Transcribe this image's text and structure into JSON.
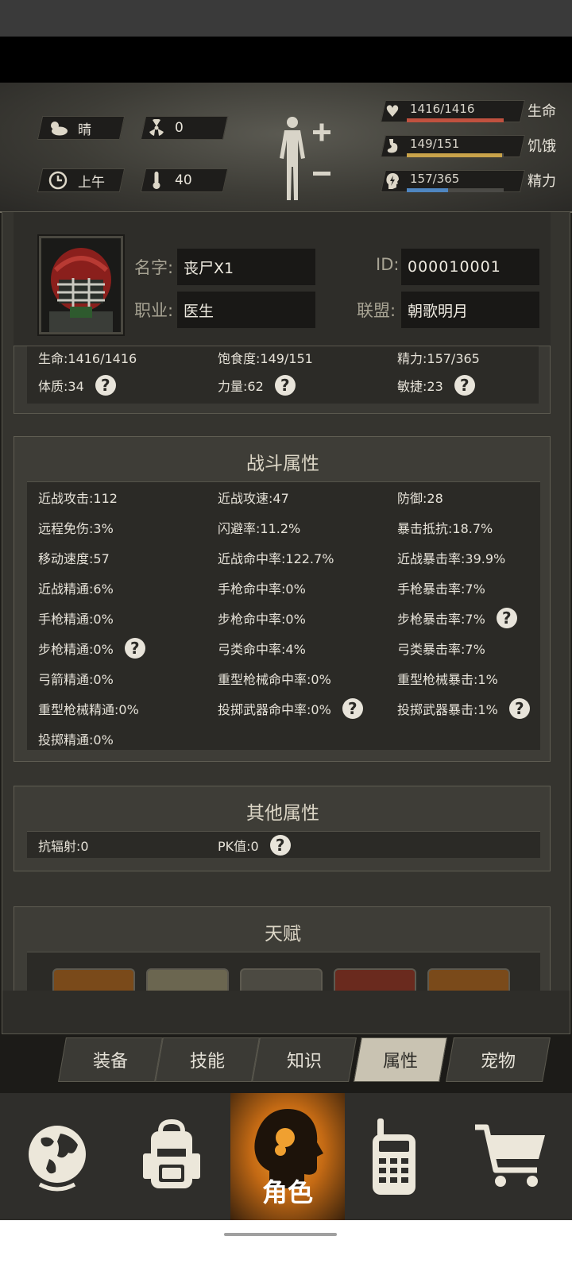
{
  "hud": {
    "weather": {
      "icon": "cloud-sun-icon",
      "value": "晴"
    },
    "radiation": {
      "icon": "radiation-icon",
      "value": "0"
    },
    "time": {
      "icon": "clock-icon",
      "value": "上午"
    },
    "temperature": {
      "icon": "thermometer-icon",
      "value": "40"
    },
    "vitals": [
      {
        "icon": "heart-icon",
        "value": "1416/1416",
        "name": "生命",
        "ratio": 1.0,
        "color": "#c0513f"
      },
      {
        "icon": "stomach-icon",
        "value": "149/151",
        "name": "饥饿",
        "ratio": 0.987,
        "color": "#c9a34a"
      },
      {
        "icon": "energy-head-icon",
        "value": "157/365",
        "name": "精力",
        "ratio": 0.43,
        "color": "#4f86c0"
      }
    ]
  },
  "profile": {
    "name_label": "名字:",
    "name": "丧尸X1",
    "id_label": "ID:",
    "id": "000010001",
    "job_label": "职业:",
    "job": "医生",
    "alliance_label": "联盟:",
    "alliance": "朝歌明月"
  },
  "basic": {
    "life": "生命:1416/1416",
    "satiety": "饱食度:149/151",
    "energy": "精力:157/365",
    "constitution": "体质:34",
    "strength": "力量:62",
    "agility": "敏捷:23"
  },
  "combat": {
    "title": "战斗属性",
    "rows": [
      [
        "近战攻击:112",
        "近战攻速:47",
        "防御:28"
      ],
      [
        "远程免伤:3%",
        "闪避率:11.2%",
        "暴击抵抗:18.7%"
      ],
      [
        "移动速度:57",
        "近战命中率:122.7%",
        "近战暴击率:39.9%"
      ],
      [
        "近战精通:6%",
        "手枪命中率:0%",
        "手枪暴击率:7%"
      ],
      [
        "手枪精通:0%",
        "步枪命中率:0%",
        "步枪暴击率:7%"
      ],
      [
        "步枪精通:0%",
        "弓类命中率:4%",
        "弓类暴击率:7%"
      ],
      [
        "弓箭精通:0%",
        "重型枪械命中率:0%",
        "重型枪械暴击:1%"
      ],
      [
        "重型枪械精通:0%",
        "投掷武器命中率:0%",
        "投掷武器暴击:1%"
      ],
      [
        "投掷精通:0%",
        "",
        ""
      ]
    ]
  },
  "other": {
    "title": "其他属性",
    "radiation_res": "抗辐射:0",
    "pk": "PK值:0"
  },
  "talent": {
    "title": "天赋"
  },
  "tabs": [
    "装备",
    "技能",
    "知识",
    "属性",
    "宠物"
  ],
  "nav": {
    "role_label": "角色",
    "icons": [
      "globe-icon",
      "backpack-icon",
      "role-head-icon",
      "walkie-talkie-icon",
      "cart-icon"
    ]
  },
  "help_glyph": "?"
}
